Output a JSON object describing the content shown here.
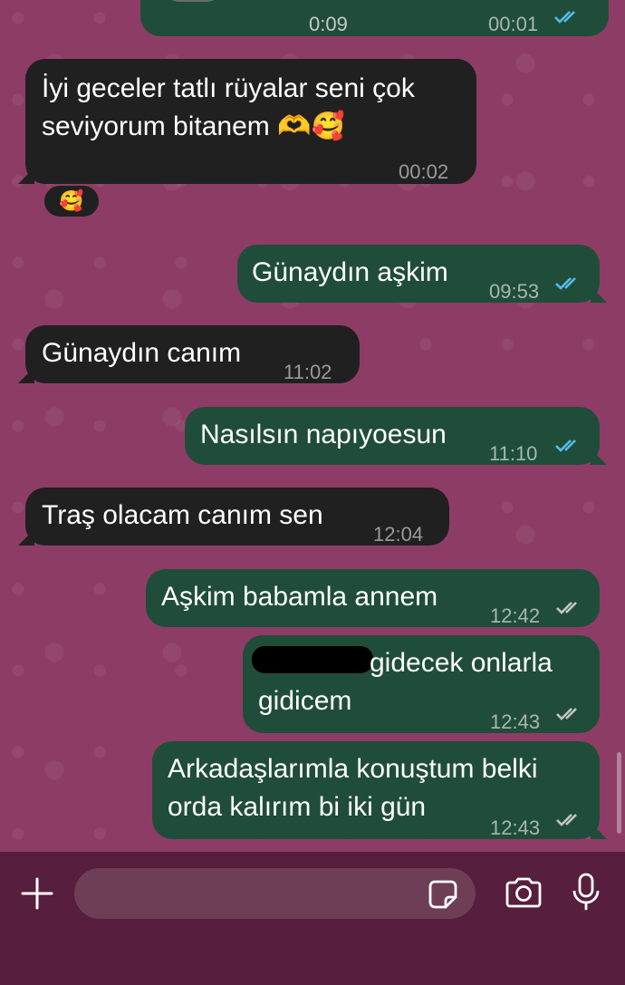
{
  "messages": [
    {
      "text": "",
      "time": "0:09",
      "time2": "00:01",
      "ticks": "read",
      "dir": "out"
    },
    {
      "lines": [
        "İyi geceler tatlı rüyalar seni çok",
        "seviyorum bitanem 🫶🥰"
      ],
      "time": "00:02",
      "dir": "in",
      "reaction": "🥰"
    },
    {
      "text": "Günaydın aşkim",
      "time": "09:53",
      "ticks": "read",
      "dir": "out"
    },
    {
      "text": "Günaydın canım",
      "time": "11:02",
      "dir": "in"
    },
    {
      "text": "Nasılsın napıyoesun",
      "time": "11:10",
      "ticks": "read",
      "dir": "out"
    },
    {
      "text": "Traş olacam canım sen",
      "time": "12:04",
      "dir": "in"
    },
    {
      "text": "Aşkim babamla annem",
      "time": "12:42",
      "ticks": "delivered",
      "dir": "out"
    },
    {
      "lines": [
        "gidecek onlarla",
        "gidicem"
      ],
      "time": "12:43",
      "ticks": "delivered",
      "dir": "out",
      "redacted": true
    },
    {
      "lines": [
        "Arkadaşlarımla konuştum belki",
        "orda kalırım bi iki gün"
      ],
      "time": "12:43",
      "ticks": "delivered",
      "dir": "out"
    }
  ],
  "colors": {
    "incoming": "#202020",
    "outgoing": "#1f4d39",
    "read_ticks": "#53bdeb",
    "delivered_ticks": "#a7b8af",
    "background": "#8d3d65",
    "footer": "#571e3d"
  },
  "footer": {
    "icons": [
      "plus-icon",
      "sticker-icon",
      "camera-icon",
      "microphone-icon"
    ]
  }
}
